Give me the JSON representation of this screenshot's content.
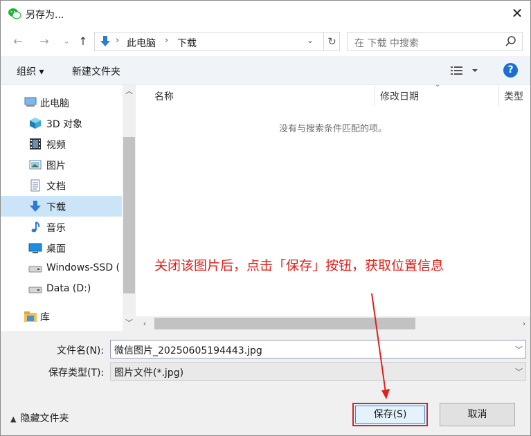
{
  "window": {
    "title": "另存为...",
    "close_label": "✕"
  },
  "nav": {
    "breadcrumbs": [
      "此电脑",
      "下载"
    ],
    "search_placeholder": "在 下载 中搜索"
  },
  "toolbar": {
    "organize_label": "组织 ▾",
    "new_folder_label": "新建文件夹",
    "help_label": "?"
  },
  "sidebar": {
    "items": [
      {
        "label": "此电脑",
        "icon": "computer-icon"
      },
      {
        "label": "3D 对象",
        "icon": "3d-objects-icon"
      },
      {
        "label": "视频",
        "icon": "video-icon"
      },
      {
        "label": "图片",
        "icon": "picture-icon"
      },
      {
        "label": "文档",
        "icon": "document-icon"
      },
      {
        "label": "下载",
        "icon": "download-icon",
        "selected": true
      },
      {
        "label": "音乐",
        "icon": "music-icon"
      },
      {
        "label": "桌面",
        "icon": "desktop-icon"
      },
      {
        "label": "Windows-SSD (",
        "icon": "drive-icon"
      },
      {
        "label": "Data (D:)",
        "icon": "drive-icon"
      },
      {
        "label": "库",
        "icon": "library-icon"
      }
    ]
  },
  "filelist": {
    "columns": [
      "名称",
      "修改日期",
      "类型"
    ],
    "empty_message": "没有与搜索条件匹配的项。"
  },
  "annotation": {
    "text": "关闭该图片后，点击「保存」按钮，获取位置信息",
    "color": "#e0201b"
  },
  "form": {
    "filename_label": "文件名(N):",
    "filename_value": "微信图片_20250605194443.jpg",
    "filetype_label": "保存类型(T):",
    "filetype_value": "图片文件(*.jpg)",
    "hide_folders_label": "隐藏文件夹",
    "save_label": "保存(S)",
    "cancel_label": "取消"
  },
  "colors": {
    "accent": "#1a6fd0",
    "selection": "#cce4f7",
    "highlight": "#d8232a"
  }
}
